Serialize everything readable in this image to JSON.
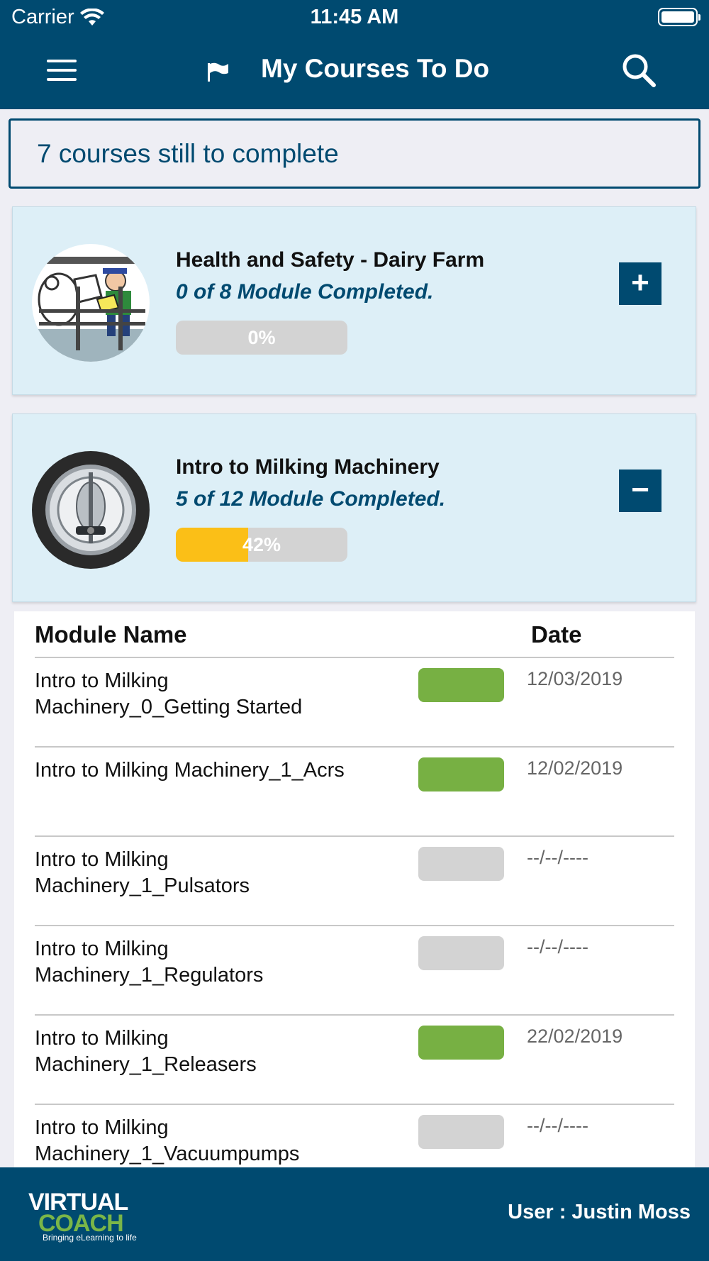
{
  "status_bar": {
    "carrier": "Carrier",
    "time": "11:45 AM"
  },
  "header": {
    "title": "My Courses To Do",
    "menu_icon": "hamburger-menu-icon",
    "flag_icon": "flag-icon",
    "search_icon": "search-icon"
  },
  "summary": {
    "text": "7 courses still to complete"
  },
  "courses": [
    {
      "name": "Health and Safety - Dairy Farm",
      "progress_text": "0 of 8 Module Completed.",
      "percent_label": "0%",
      "percent": 0,
      "toggle": "+",
      "expanded": false
    },
    {
      "name": "Intro to Milking Machinery",
      "progress_text": "5 of 12 Module Completed.",
      "percent_label": "42%",
      "percent": 42,
      "toggle": "−",
      "expanded": true
    }
  ],
  "modules": {
    "col_name": "Module Name",
    "col_date": "Date",
    "rows": [
      {
        "name": "Intro to Milking Machinery_0_Getting Started",
        "status": "complete",
        "date": "12/03/2019"
      },
      {
        "name": "Intro to Milking Machinery_1_Acrs",
        "status": "complete",
        "date": "12/02/2019"
      },
      {
        "name": "Intro to Milking Machinery_1_Pulsators",
        "status": "incomplete",
        "date": "--/--/----"
      },
      {
        "name": "Intro to Milking Machinery_1_Regulators",
        "status": "incomplete",
        "date": "--/--/----"
      },
      {
        "name": "Intro to Milking Machinery_1_Releasers",
        "status": "complete",
        "date": "22/02/2019"
      },
      {
        "name": "Intro to Milking Machinery_1_Vacuumpumps",
        "status": "incomplete",
        "date": "--/--/----"
      }
    ]
  },
  "colors": {
    "primary": "#004a70",
    "card_bg": "#ddeff7",
    "progress": "#fbbf17",
    "complete": "#77b043",
    "incomplete": "#d3d3d3"
  },
  "footer": {
    "logo_line1": "VIRTUAL",
    "logo_line2": "COACH",
    "logo_tagline": "Bringing eLearning to life",
    "user": "User : Justin Moss"
  }
}
